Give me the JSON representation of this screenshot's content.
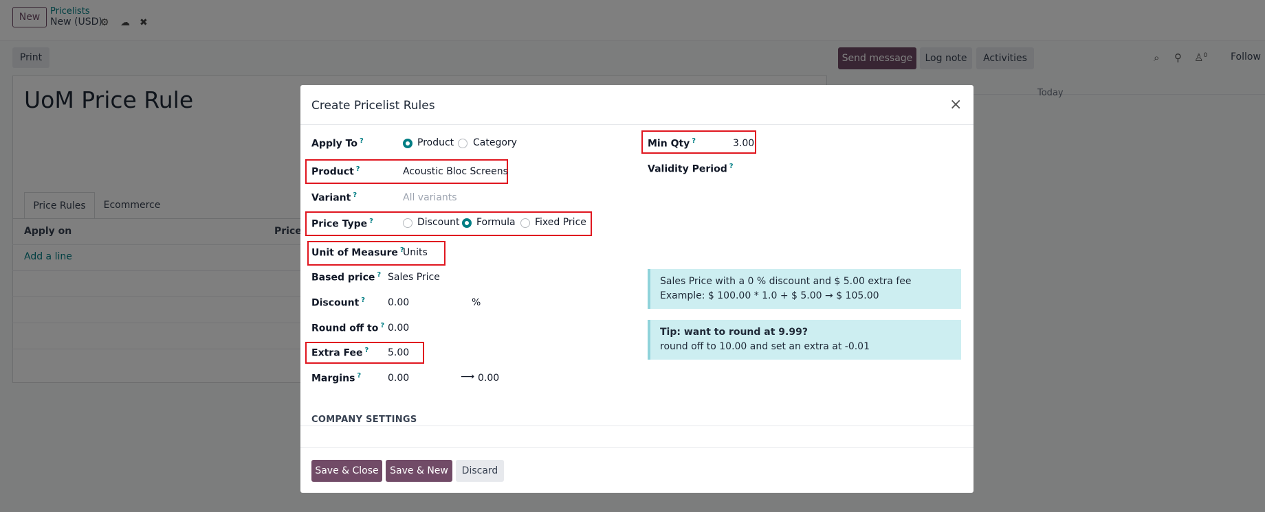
{
  "control_panel": {
    "new_label": "New",
    "breadcrumb_parent": "Pricelists",
    "breadcrumb_current": "New (USD)",
    "print_label": "Print",
    "send_message_label": "Send message",
    "log_note_label": "Log note",
    "activities_label": "Activities",
    "follower_count": "0",
    "follow_label": "Follow",
    "today_label": "Today"
  },
  "record": {
    "title": "UoM Price Rule",
    "tabs": [
      "Price Rules",
      "Ecommerce"
    ],
    "columns": [
      "Apply on",
      "Price"
    ],
    "add_line_label": "Add a line"
  },
  "modal": {
    "title": "Create Pricelist Rules",
    "apply_to": {
      "label": "Apply To",
      "options": [
        "Product",
        "Category"
      ],
      "selected": "Product"
    },
    "product": {
      "label": "Product",
      "value": "Acoustic Bloc Screens"
    },
    "variant": {
      "label": "Variant",
      "placeholder": "All variants"
    },
    "price_type": {
      "label": "Price Type",
      "options": [
        "Discount",
        "Formula",
        "Fixed Price"
      ],
      "selected": "Formula"
    },
    "uom": {
      "label": "Unit of Measure",
      "value": "Units"
    },
    "based_price": {
      "label": "Based price",
      "value": "Sales Price"
    },
    "discount": {
      "label": "Discount",
      "value": "0.00",
      "unit": "%"
    },
    "round_off": {
      "label": "Round off to",
      "value": "0.00"
    },
    "extra_fee": {
      "label": "Extra Fee",
      "value": "5.00"
    },
    "margins": {
      "label": "Margins",
      "min": "0.00",
      "arrow": "⟶",
      "max": "0.00"
    },
    "min_qty": {
      "label": "Min Qty",
      "value": "3.00"
    },
    "validity": {
      "label": "Validity Period"
    },
    "info_line1": "Sales Price with a 0 % discount and $ 5.00 extra fee",
    "info_line2": "Example: $ 100.00 * 1.0 + $ 5.00 → $ 105.00",
    "tip_title": "Tip: want to round at 9.99?",
    "tip_text": "round off to 10.00 and set an extra at -0.01",
    "section_company": "COMPANY SETTINGS",
    "buttons": {
      "save_close": "Save & Close",
      "save_new": "Save & New",
      "discard": "Discard"
    }
  },
  "colors": {
    "brand": "#714B67",
    "accent": "#017e84",
    "highlight": "#e0161f",
    "info_bg": "#cdeef1"
  }
}
